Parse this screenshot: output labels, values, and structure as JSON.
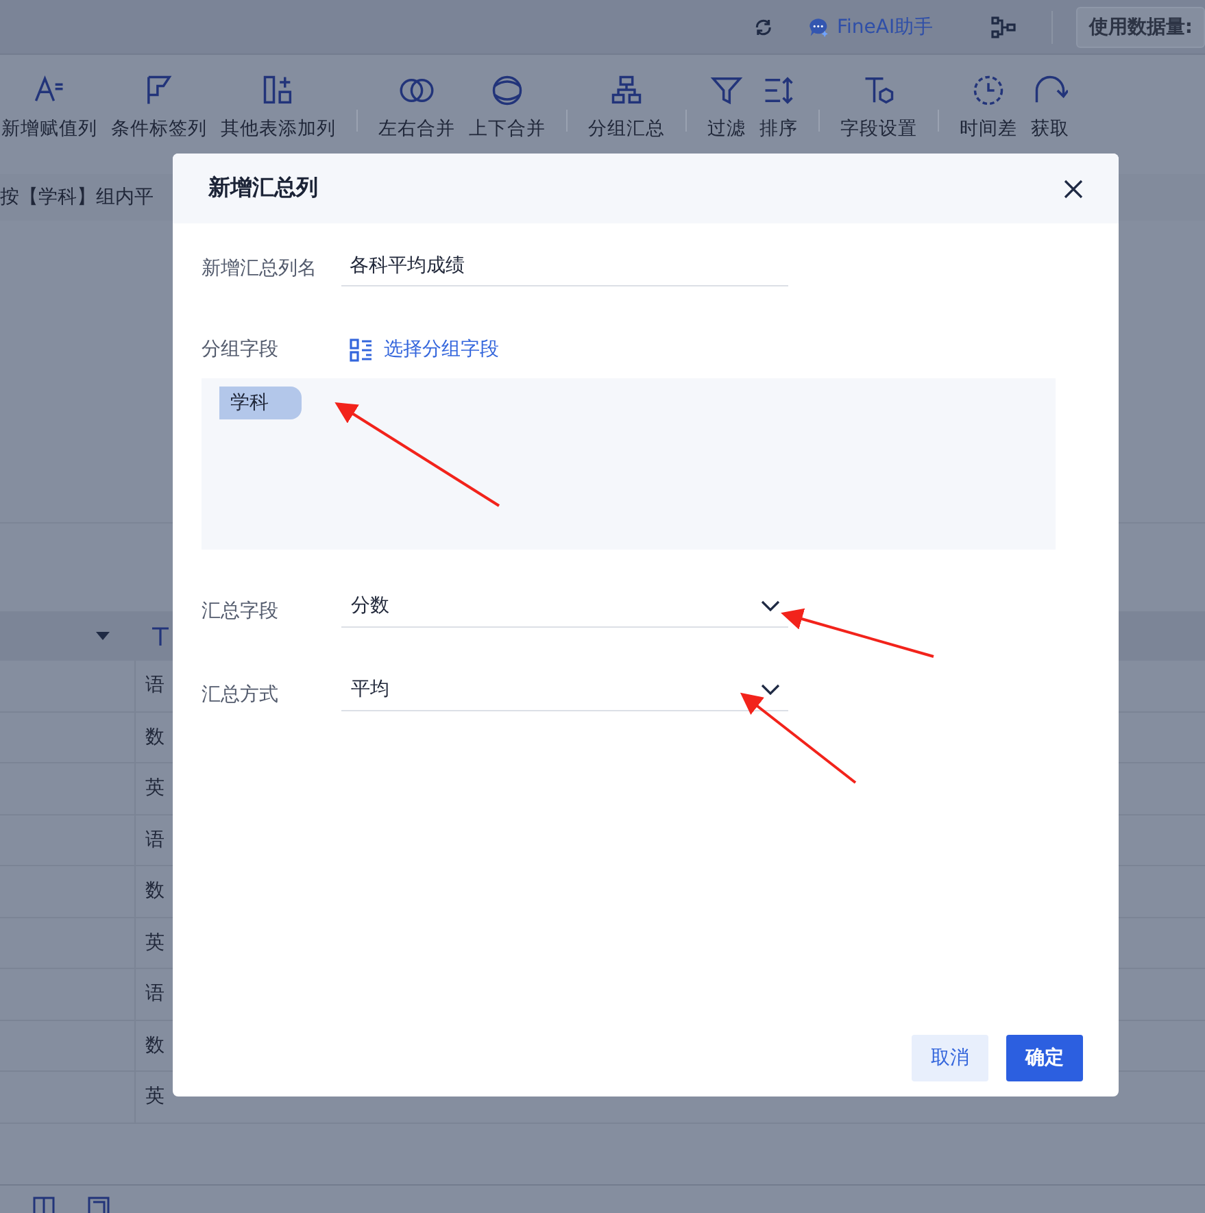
{
  "top_bar": {
    "assistant_label": "FineAI助手",
    "usage_label": "使用数据量:"
  },
  "toolbar": {
    "groups": [
      {
        "items": [
          {
            "kind": "assign",
            "label": "新增赋值列"
          },
          {
            "kind": "flag",
            "label": "条件标签列"
          },
          {
            "kind": "addcol",
            "label": "其他表添加列"
          }
        ]
      },
      {
        "items": [
          {
            "kind": "lr",
            "label": "左右合并"
          },
          {
            "kind": "tb",
            "label": "上下合并"
          }
        ]
      },
      {
        "items": [
          {
            "kind": "group",
            "label": "分组汇总"
          }
        ]
      },
      {
        "items": [
          {
            "kind": "filter",
            "label": "过滤"
          },
          {
            "kind": "sort",
            "label": "排序"
          }
        ]
      },
      {
        "items": [
          {
            "kind": "field",
            "label": "字段设置"
          }
        ]
      },
      {
        "items": [
          {
            "kind": "clock",
            "label": "时间差"
          },
          {
            "kind": "fetch",
            "label": "获取"
          }
        ]
      }
    ]
  },
  "step_description": "按【学科】组内平",
  "table": {
    "rows": [
      {
        "cell": "语"
      },
      {
        "cell": "数"
      },
      {
        "cell": "英"
      },
      {
        "cell": "语"
      },
      {
        "cell": "数"
      },
      {
        "cell": "英"
      },
      {
        "cell": "语"
      },
      {
        "cell": "数"
      },
      {
        "cell": "英"
      }
    ]
  },
  "dialog": {
    "title": "新增汇总列",
    "name_field": {
      "label": "新增汇总列名",
      "value": "各科平均成绩"
    },
    "group_fields": {
      "label": "分组字段",
      "link": "选择分组字段",
      "tags": [
        "学科"
      ]
    },
    "selects": [
      {
        "label": "汇总字段",
        "value": "分数"
      },
      {
        "label": "汇总方式",
        "value": "平均"
      }
    ],
    "buttons": [
      {
        "label": "取消",
        "kind": "secondary"
      },
      {
        "label": "确定",
        "kind": "primary"
      }
    ]
  }
}
